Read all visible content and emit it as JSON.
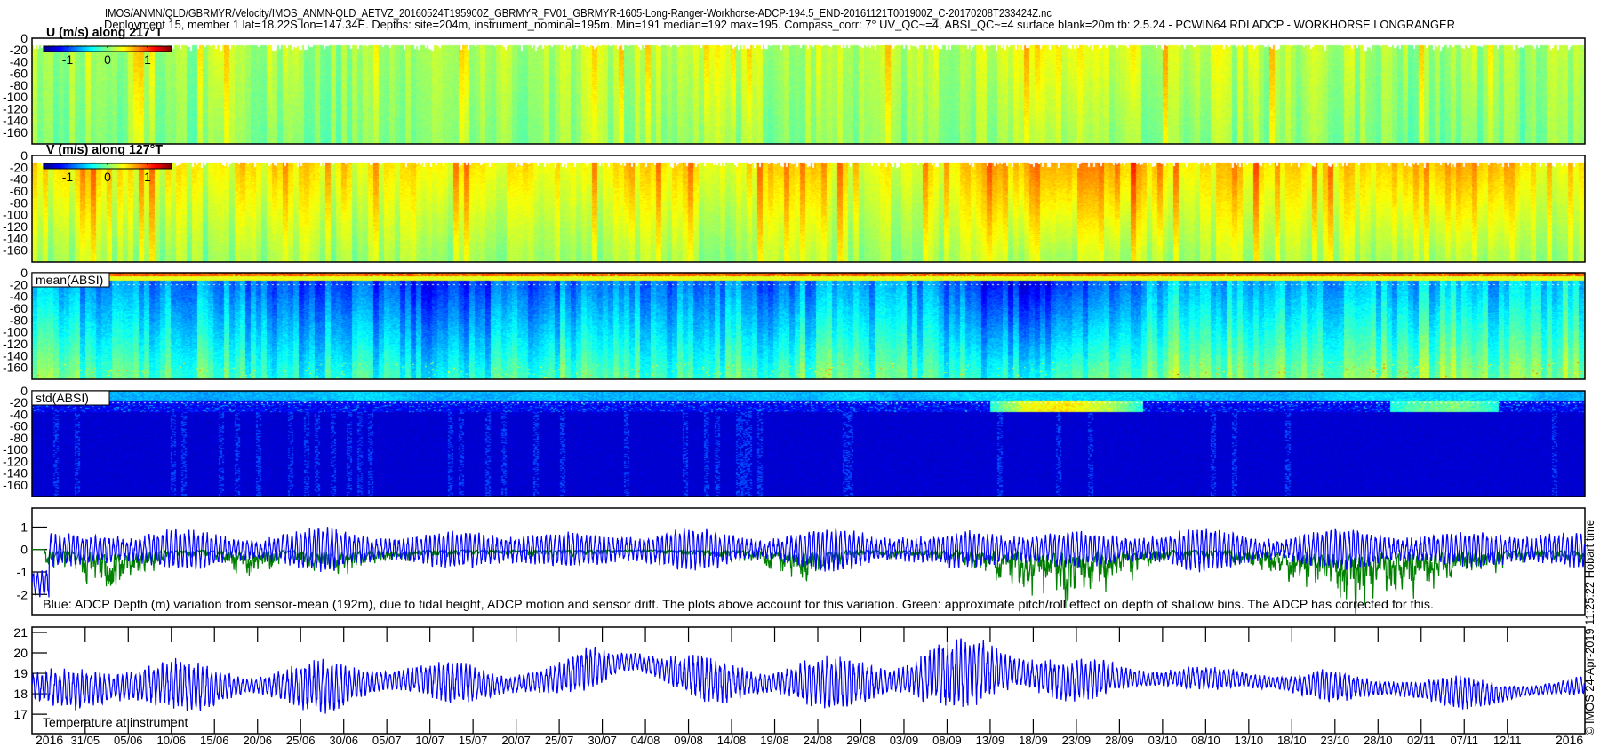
{
  "title": {
    "line1": "IMOS/ANMN/QLD/GBRMYR/Velocity/IMOS_ANMN-QLD_AETVZ_20160524T195900Z_GBRMYR_FV01_GBRMYR-1605-Long-Ranger-Workhorse-ADCP-194.5_END-20161121T001900Z_C-20170208T233424Z.nc",
    "line2": "Deployment 15, member 1 lat=18.22S lon=147.34E. Depths: site=204m, instrument_nominal=195m. Min=191 median=192 max=195. Compass_corr: 7° UV_QC~=4, ABSI_QC~=4 surface blank=20m tb: 2.5.24 - PCWIN64 RDI ADCP - WORKHORSE LONGRANGER"
  },
  "credit": "© IMOS 24-Apr-2019 11:25:22 Hobart time",
  "x_axis": {
    "xlim": [
      "2016-05-24T20:00",
      "2016-11-21T00:00"
    ],
    "year_label_left": "2016",
    "year_label_right": "2016",
    "ticks": [
      "31/05",
      "05/06",
      "10/06",
      "15/06",
      "20/06",
      "25/06",
      "30/06",
      "05/07",
      "10/07",
      "15/07",
      "20/07",
      "25/07",
      "30/07",
      "04/08",
      "09/08",
      "14/08",
      "19/08",
      "24/08",
      "29/08",
      "03/09",
      "08/09",
      "13/09",
      "18/09",
      "23/09",
      "28/09",
      "03/10",
      "08/10",
      "13/10",
      "18/10",
      "23/10",
      "28/10",
      "02/11",
      "07/11",
      "12/11"
    ]
  },
  "colors": {
    "blue_series": "#0000ff",
    "green_series": "#008000",
    "colormap": "jet"
  },
  "chart_data": [
    {
      "type": "heatmap",
      "id": "u",
      "title": "U (m/s) along 217°T",
      "ylim": [
        -180,
        0
      ],
      "yticks": [
        "0",
        "-20",
        "-40",
        "-60",
        "-80",
        "-100",
        "-120",
        "-140",
        "-160"
      ],
      "colorbar": {
        "range": [
          -1.6,
          1.6
        ],
        "ticks": [
          "-1",
          "0",
          "1"
        ]
      },
      "surface_blank_depth": -12,
      "note": "",
      "upper_5day_mean": [
        0.1,
        0.1,
        0.15,
        0.1,
        0.1,
        0.15,
        0.1,
        0.1,
        0.15,
        0.1,
        0.15,
        0.2,
        0.15,
        0.2,
        0.25,
        0.2,
        0.3,
        0.2,
        0.15,
        0.15,
        0.2,
        0.15,
        0.25,
        0.3,
        0.35,
        0.3,
        0.2,
        0.3,
        0.2,
        0.15,
        0.2,
        0.15,
        0.1,
        0.15,
        0.1,
        0.1,
        0.1
      ],
      "lower_5day_mean": [
        0.0,
        0.0,
        0.05,
        0.0,
        0.0,
        0.05,
        0.0,
        0.0,
        0.05,
        0.0,
        0.05,
        0.05,
        0.05,
        0.1,
        0.1,
        0.05,
        0.1,
        0.05,
        0.05,
        0.05,
        0.05,
        0.05,
        0.1,
        0.1,
        0.1,
        0.1,
        0.05,
        0.1,
        0.05,
        0.05,
        0.05,
        0.05,
        0.0,
        0.0,
        0.0,
        0.0,
        0.0
      ]
    },
    {
      "type": "heatmap",
      "id": "v",
      "title": "V (m/s) along 127°T",
      "ylim": [
        -180,
        0
      ],
      "yticks": [
        "0",
        "-20",
        "-40",
        "-60",
        "-80",
        "-100",
        "-120",
        "-140",
        "-160"
      ],
      "colorbar": {
        "range": [
          -1.6,
          1.6
        ],
        "ticks": [
          "-1",
          "0",
          "1"
        ]
      },
      "surface_blank_depth": -12,
      "upper_5day_mean": [
        0.45,
        0.5,
        0.5,
        0.4,
        0.35,
        0.45,
        0.5,
        0.45,
        0.4,
        0.45,
        0.5,
        0.45,
        0.4,
        0.45,
        0.5,
        0.55,
        0.45,
        0.4,
        0.45,
        0.4,
        0.35,
        0.4,
        0.55,
        0.75,
        0.8,
        0.75,
        0.6,
        0.5,
        0.55,
        0.6,
        0.5,
        0.55,
        0.7,
        0.75,
        0.65,
        0.5,
        0.45
      ],
      "lower_5day_mean": [
        0.1,
        0.1,
        0.15,
        0.1,
        0.05,
        0.1,
        0.15,
        0.1,
        0.1,
        0.1,
        0.1,
        0.1,
        0.1,
        0.1,
        0.15,
        0.15,
        0.1,
        0.1,
        0.1,
        0.1,
        0.05,
        0.1,
        0.15,
        0.2,
        0.2,
        0.2,
        0.15,
        0.15,
        0.15,
        0.2,
        0.15,
        0.15,
        0.2,
        0.2,
        0.15,
        0.15,
        0.1
      ]
    },
    {
      "type": "heatmap",
      "id": "mean",
      "title": "mean(ABSI)",
      "ylim": [
        -180,
        0
      ],
      "yticks": [
        "0",
        "-20",
        "-40",
        "-60",
        "-80",
        "-100",
        "-120",
        "-140",
        "-160"
      ],
      "color_level_unit": "colormap fraction 0-1",
      "upper_5day_mean": [
        0.3,
        0.28,
        0.25,
        0.27,
        0.25,
        0.22,
        0.2,
        0.2,
        0.18,
        0.15,
        0.17,
        0.2,
        0.22,
        0.25,
        0.25,
        0.22,
        0.25,
        0.22,
        0.25,
        0.28,
        0.27,
        0.25,
        0.15,
        0.12,
        0.15,
        0.2,
        0.3,
        0.32,
        0.28,
        0.3,
        0.27,
        0.28,
        0.3,
        0.32,
        0.3,
        0.33,
        0.35
      ],
      "lower_5day_mean": [
        0.5,
        0.48,
        0.45,
        0.47,
        0.45,
        0.42,
        0.4,
        0.42,
        0.4,
        0.38,
        0.4,
        0.42,
        0.45,
        0.47,
        0.45,
        0.42,
        0.45,
        0.45,
        0.47,
        0.48,
        0.45,
        0.43,
        0.4,
        0.4,
        0.42,
        0.45,
        0.5,
        0.52,
        0.48,
        0.5,
        0.47,
        0.48,
        0.5,
        0.52,
        0.5,
        0.5,
        0.52
      ]
    },
    {
      "type": "heatmap",
      "id": "std",
      "title": "std(ABSI)",
      "ylim": [
        -180,
        0
      ],
      "yticks": [
        "0",
        "-20",
        "-40",
        "-60",
        "-80",
        "-100",
        "-120",
        "-140",
        "-160"
      ],
      "color_level_unit": "colormap fraction 0-1",
      "surface_5day_level": [
        0.3,
        0.32,
        0.3,
        0.3,
        0.28,
        0.3,
        0.3,
        0.32,
        0.35,
        0.3,
        0.3,
        0.3,
        0.32,
        0.3,
        0.3,
        0.3,
        0.3,
        0.32,
        0.3,
        0.35,
        0.3,
        0.32,
        0.35,
        0.6,
        0.65,
        0.55,
        0.35,
        0.3,
        0.3,
        0.3,
        0.32,
        0.35,
        0.45,
        0.5,
        0.4,
        0.3,
        0.3
      ],
      "deep_level": 0.08
    },
    {
      "type": "line",
      "id": "depth",
      "ylim": [
        -2.9,
        1.85
      ],
      "yticks": [
        "1",
        "0",
        "-1",
        "-2"
      ],
      "annotation": "Blue: ADCP Depth (m) variation from sensor-mean (192m), due to tidal height, ADCP motion and sensor drift. The plots above account for this variation. Green: approximate pitch/roll effect on depth of shallow bins. The ADCP has corrected for this.",
      "blue_5day_amplitude": [
        0.6,
        0.6,
        0.8,
        0.9,
        0.7,
        0.6,
        0.8,
        0.9,
        0.7,
        0.6,
        0.8,
        0.9,
        0.7,
        0.6,
        0.8,
        0.9,
        0.7,
        0.6,
        0.8,
        0.9,
        0.7,
        0.6,
        0.8,
        0.9,
        0.7,
        0.6,
        0.8,
        0.9,
        0.7,
        0.6,
        0.8,
        0.9,
        0.7,
        0.6,
        0.8,
        0.9,
        0.7
      ],
      "green_5day_dip": [
        1.2,
        1.8,
        2.5,
        0.8,
        0.5,
        1.5,
        1.0,
        1.5,
        1.0,
        0.4,
        0.3,
        0.3,
        0.4,
        0.3,
        0.2,
        0.3,
        0.5,
        0.8,
        2.0,
        0.4,
        0.5,
        0.6,
        1.5,
        2.5,
        3.0,
        2.0,
        1.0,
        0.5,
        0.8,
        1.5,
        2.5,
        3.0,
        2.5,
        1.5,
        1.0,
        0.5,
        0.8
      ]
    },
    {
      "type": "line",
      "id": "temp",
      "ylim": [
        16.05,
        21.26
      ],
      "yticks": [
        "21",
        "20",
        "19",
        "18",
        "17"
      ],
      "annotation": "Temperature at instrument",
      "mean_5day": [
        18.4,
        18.2,
        18.3,
        18.5,
        18.3,
        18.4,
        18.4,
        18.3,
        18.6,
        18.7,
        18.5,
        18.4,
        18.7,
        19.3,
        19.6,
        19.0,
        18.6,
        18.5,
        18.6,
        18.5,
        18.6,
        18.9,
        19.2,
        19.0,
        18.6,
        18.8,
        18.7,
        18.8,
        18.7,
        18.5,
        18.4,
        18.3,
        18.2,
        18.1,
        18.0,
        18.2,
        18.4
      ],
      "amplitude_5day": [
        0.9,
        1.1,
        1.4,
        1.6,
        1.2,
        0.8,
        1.3,
        1.5,
        1.0,
        0.9,
        1.2,
        0.9,
        0.8,
        1.2,
        0.9,
        1.0,
        1.4,
        1.0,
        1.3,
        1.6,
        1.2,
        1.8,
        2.0,
        1.5,
        1.1,
        1.0,
        0.8,
        0.6,
        0.6,
        0.7,
        0.9,
        0.6,
        0.8,
        0.9,
        0.7,
        0.5,
        0.5
      ]
    }
  ]
}
